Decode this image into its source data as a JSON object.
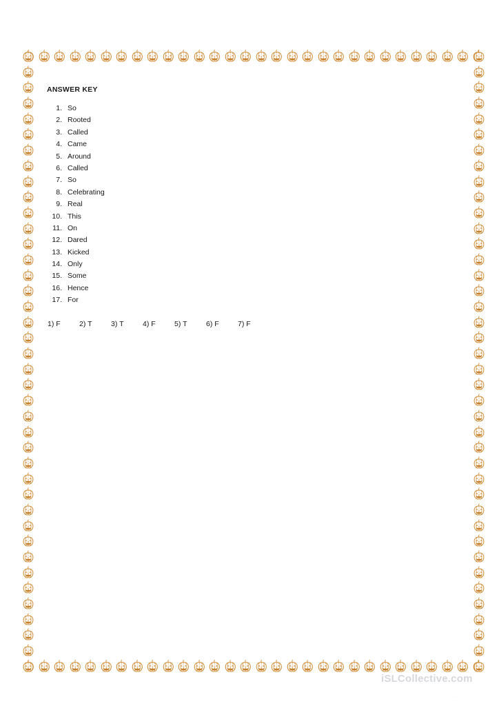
{
  "page": {
    "background_color": "#ffffff",
    "border_icon": "pumpkin-icon",
    "border_color": "#d8913f"
  },
  "content": {
    "title": "ANSWER KEY",
    "answers": [
      {
        "number": "1.",
        "word": "So"
      },
      {
        "number": "2.",
        "word": "Rooted"
      },
      {
        "number": "3.",
        "word": "Called"
      },
      {
        "number": "4.",
        "word": "Came"
      },
      {
        "number": "5.",
        "word": "Around"
      },
      {
        "number": "6.",
        "word": "Called"
      },
      {
        "number": "7.",
        "word": "So"
      },
      {
        "number": "8.",
        "word": "Celebrating"
      },
      {
        "number": "9.",
        "word": "Real"
      },
      {
        "number": "10.",
        "word": "This"
      },
      {
        "number": "11.",
        "word": "On"
      },
      {
        "number": "12.",
        "word": "Dared"
      },
      {
        "number": "13.",
        "word": "Kicked"
      },
      {
        "number": "14.",
        "word": "Only"
      },
      {
        "number": "15.",
        "word": "Some"
      },
      {
        "number": "16.",
        "word": "Hence"
      },
      {
        "number": "17.",
        "word": "For"
      }
    ],
    "true_false": [
      "1) F",
      "2) T",
      "3) T",
      "4) F",
      "5) T",
      "6) F",
      "7) F"
    ]
  },
  "watermark": {
    "text": "iSLCollective.com",
    "color": "#d6d8dc",
    "corner_mark": "·"
  }
}
